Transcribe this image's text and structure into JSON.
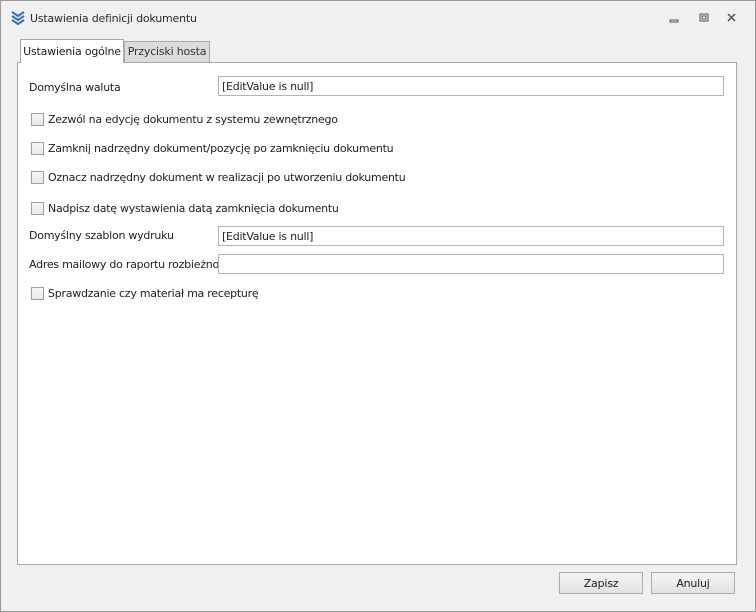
{
  "window": {
    "title": "Ustawienia definicji dokumentu",
    "icon": "chevron-stack-icon",
    "controls": [
      "minimize-icon",
      "restore-icon",
      "close-icon"
    ]
  },
  "tabs": [
    {
      "label": "Ustawienia ogólne",
      "active": true
    },
    {
      "label": "Przyciski hosta",
      "active": false
    }
  ],
  "form": {
    "currency_label": "Domyślna waluta",
    "currency_value": "[EditValue is null]",
    "allow_external_edit": {
      "label": "Zezwól na edycję dokumentu z systemu zewnętrznego",
      "checked": false
    },
    "close_parent": {
      "label": "Zamknij nadrzędny dokument/pozycję po zamknięciu dokumentu",
      "checked": false
    },
    "mark_parent_in_progress": {
      "label": "Oznacz nadrzędny dokument w realizacji po utworzeniu dokumentu",
      "checked": false
    },
    "overwrite_issue_date": {
      "label": "Nadpisz datę wystawienia datą zamknięcia dokumentu",
      "checked": false
    },
    "print_template_label": "Domyślny szablon wydruku",
    "print_template_value": "[EditValue is null]",
    "discrepancy_email_label": "Adres mailowy do raportu rozbieżności",
    "discrepancy_email_value": "",
    "recipe_check": {
      "label": "Sprawdzanie czy materiał ma recepturę",
      "checked": false
    }
  },
  "footer": {
    "save_label": "Zapisz",
    "cancel_label": "Anuluj"
  },
  "colors": {
    "window_bg": "#f0f0f0",
    "panel_bg": "#ffffff",
    "border": "#a9a9a9",
    "icon_blue": "#3d6fb6"
  }
}
